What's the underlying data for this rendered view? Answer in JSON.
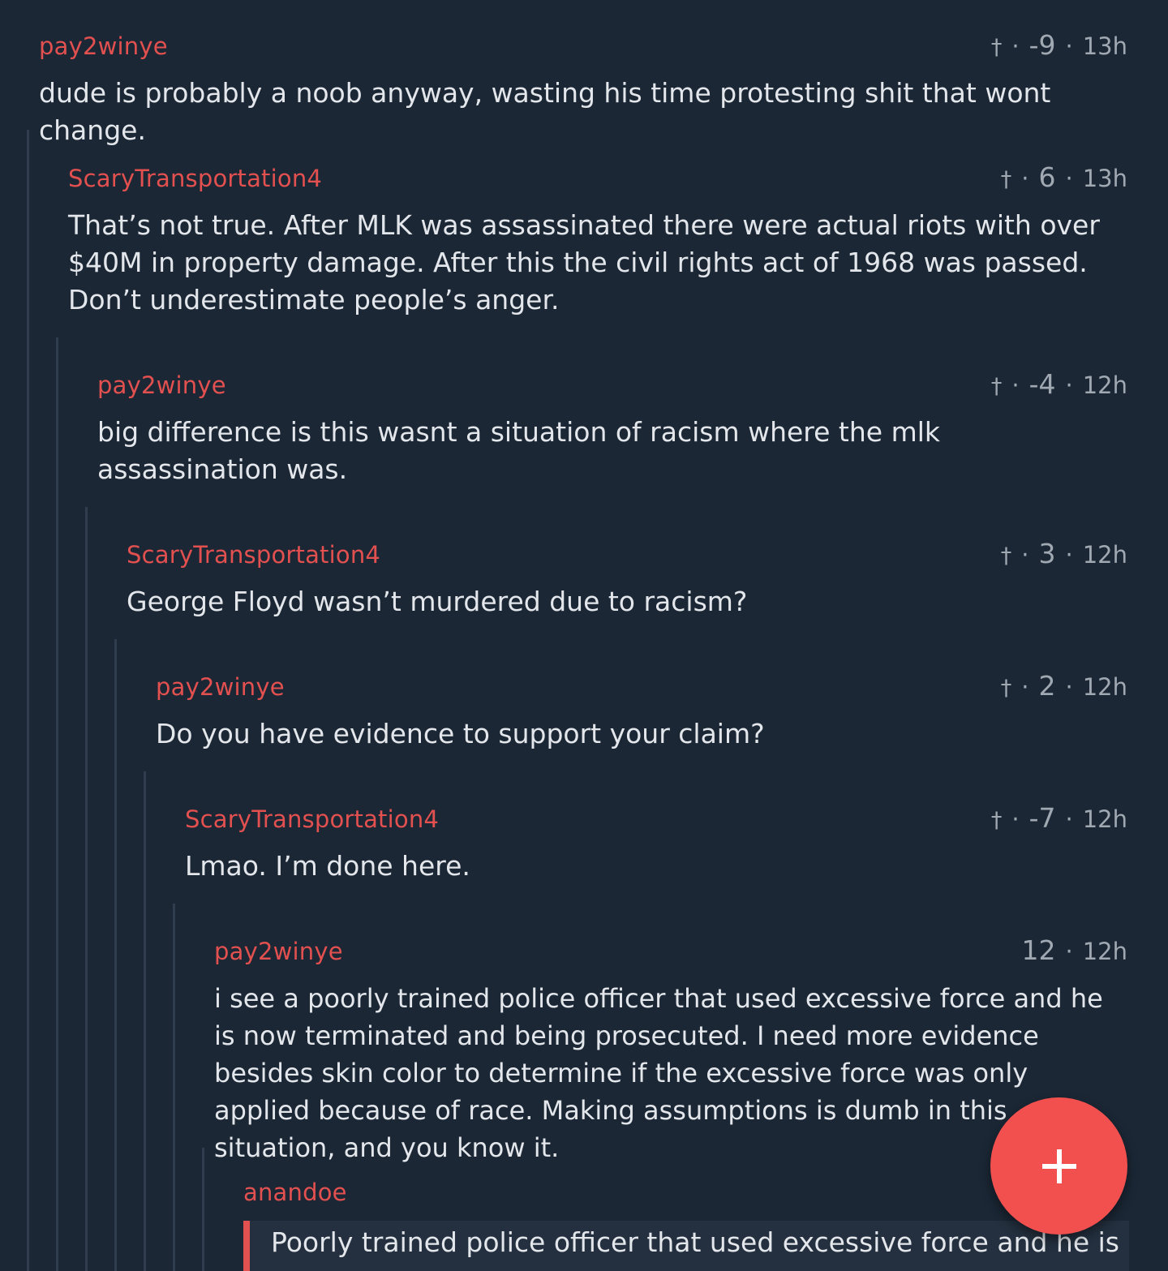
{
  "comments": [
    {
      "author": "pay2winye",
      "icon": "dagger-icon",
      "score": "-9",
      "time": "13h",
      "body": "dude is probably a noob anyway, wasting his time protesting shit that wont change."
    },
    {
      "author": "ScaryTransportation4",
      "icon": "dagger-icon",
      "score": "6",
      "time": "13h",
      "body": "That’s not true. After MLK was assassinated there were actual riots with over $40M in property damage. After this the civil rights act of 1968 was passed. Don’t underestimate people’s anger."
    },
    {
      "author": "pay2winye",
      "icon": "dagger-icon",
      "score": "-4",
      "time": "12h",
      "body": "big difference is this wasnt a situation of racism where the mlk assassination was."
    },
    {
      "author": "ScaryTransportation4",
      "icon": "dagger-icon",
      "score": "3",
      "time": "12h",
      "body": "George Floyd wasn’t murdered due to racism?"
    },
    {
      "author": "pay2winye",
      "icon": "dagger-icon",
      "score": "2",
      "time": "12h",
      "body": "Do you have evidence to support your claim?"
    },
    {
      "author": "ScaryTransportation4",
      "icon": "dagger-icon",
      "score": "-7",
      "time": "12h",
      "body": "Lmao. I’m done here."
    },
    {
      "author": "pay2winye",
      "score": "12",
      "time": "12h",
      "body": "i see a poorly trained police officer that used excessive force and he is now terminated and being prosecuted. I need more evidence besides skin color to determine if the excessive force was only applied because of race. Making assumptions is dumb in this situation, and you know it."
    },
    {
      "author": "anandoe",
      "quote": "Poorly trained police officer that used excessive force and he is"
    }
  ],
  "fab": {
    "icon": "plus-icon",
    "color": "#f2504e"
  },
  "colors": {
    "background": "#1b2735",
    "author": "#e2504f",
    "meta": "#a0a8b2",
    "text": "#e3e6ea",
    "guide": "#2f3d4e"
  }
}
